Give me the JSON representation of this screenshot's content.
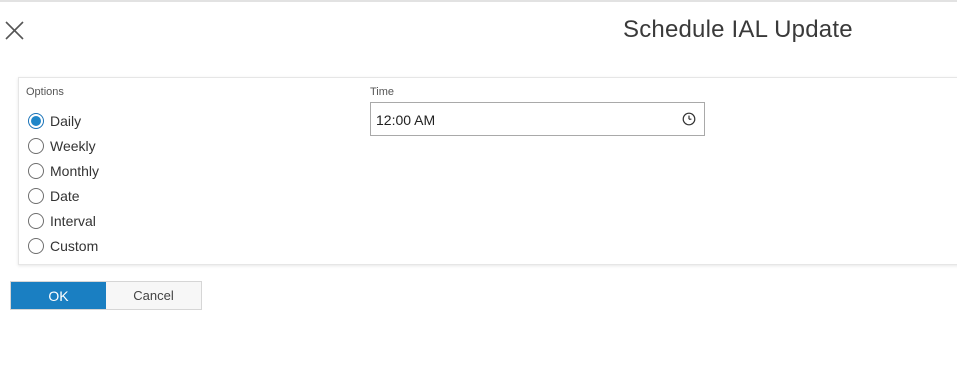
{
  "dialog": {
    "title": "Schedule IAL Update",
    "close_icon": "close-icon"
  },
  "options": {
    "label": "Options",
    "selected": "Daily",
    "items": [
      {
        "label": "Daily",
        "checked": true
      },
      {
        "label": "Weekly",
        "checked": false
      },
      {
        "label": "Monthly",
        "checked": false
      },
      {
        "label": "Date",
        "checked": false
      },
      {
        "label": "Interval",
        "checked": false
      },
      {
        "label": "Custom",
        "checked": false
      }
    ]
  },
  "time": {
    "label": "Time",
    "value": "12:00 AM",
    "icon": "clock-icon"
  },
  "buttons": {
    "ok_label": "OK",
    "cancel_label": "Cancel"
  },
  "colors": {
    "accent": "#1a7fc2",
    "radio_selected": "#1f86c9"
  }
}
